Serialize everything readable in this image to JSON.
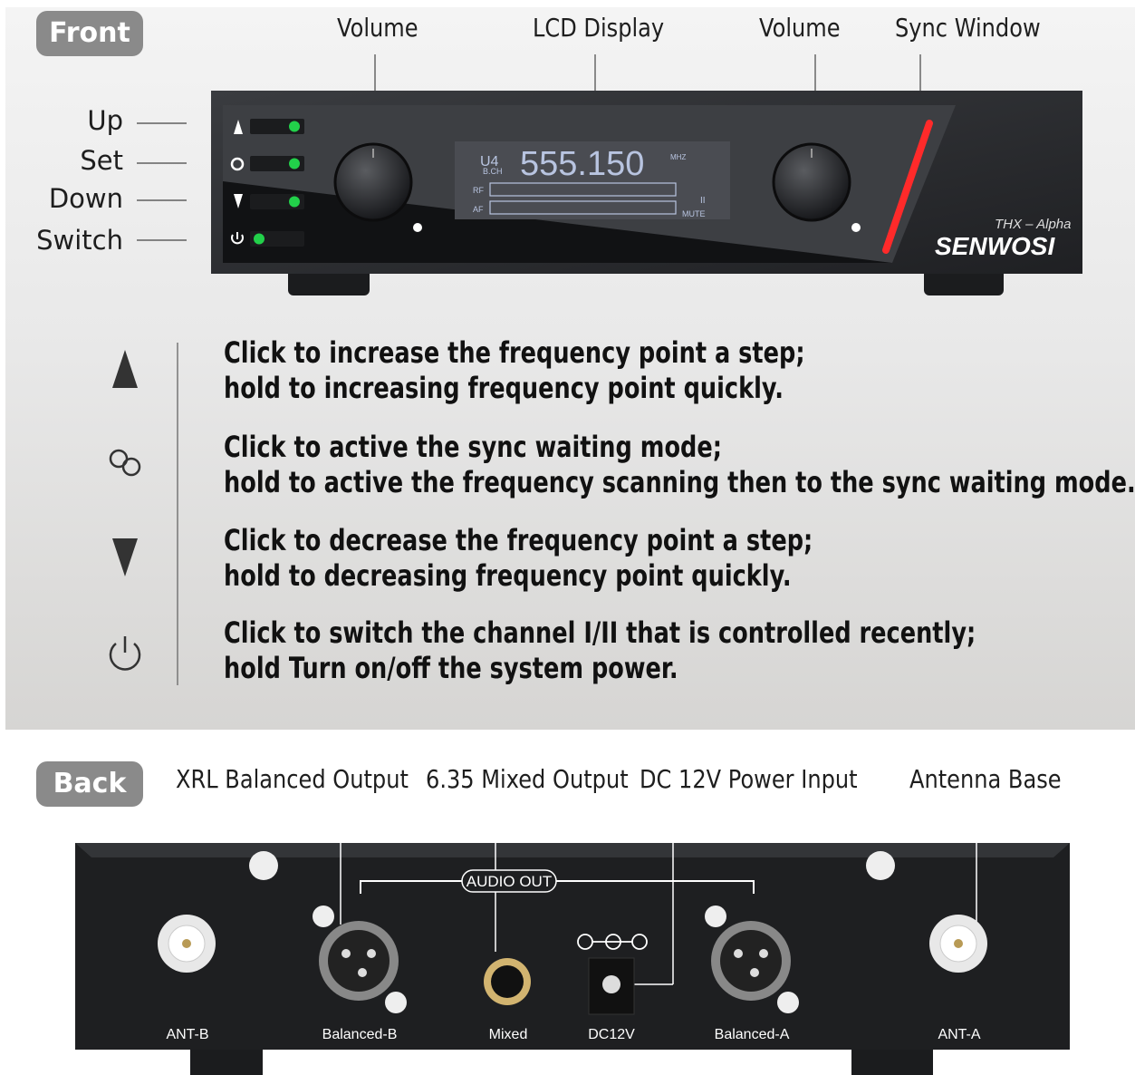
{
  "front": {
    "badge": "Front",
    "top_labels": {
      "volume_left": "Volume",
      "lcd_display": "LCD Display",
      "volume_right": "Volume",
      "sync_window": "Sync Window"
    },
    "side_labels": {
      "up": "Up",
      "set": "Set",
      "down": "Down",
      "switch": "Switch"
    },
    "device": {
      "lcd_freq": "555.150",
      "lcd_small": "U4",
      "lcd_bch": "B.CH",
      "lcd_mhz": "MHZ",
      "lcd_rf": "RF",
      "lcd_af": "AF",
      "lcd_channel": "II",
      "lcd_mute": "MUTE",
      "model": "THX – Alpha",
      "brand": "SENWOSI"
    },
    "descriptions": [
      {
        "icon": "up-arrow-icon",
        "line1": "Click to increase the frequency point a step;",
        "line2": "hold to increasing frequency point quickly."
      },
      {
        "icon": "gear-icon",
        "line1": "Click to active the sync waiting mode;",
        "line2": "hold to active the frequency scanning then to the sync waiting mode."
      },
      {
        "icon": "down-arrow-icon",
        "line1": "Click to decrease the frequency point a step;",
        "line2": "hold to decreasing frequency point quickly."
      },
      {
        "icon": "power-icon",
        "line1": "Click to switch the channel I/II that is controlled recently;",
        "line2": "hold Turn on/off the system power."
      }
    ]
  },
  "back": {
    "badge": "Back",
    "top_labels": {
      "xrl": "XRL Balanced Output",
      "mixed_out": "6.35 Mixed Output",
      "dc_power": "DC 12V Power Input",
      "antenna": "Antenna Base"
    },
    "panel": {
      "audio_out": "AUDIO OUT",
      "ports": [
        "ANT-B",
        "Balanced-B",
        "Mixed",
        "DC12V",
        "Balanced-A",
        "ANT-A"
      ]
    }
  },
  "colors": {
    "badge": "#8a8a8a",
    "device_body": "#2b2d30",
    "led_green": "#22d04a",
    "sync_red": "#ff2a2a",
    "lcd_blue": "#b8c4e0"
  }
}
